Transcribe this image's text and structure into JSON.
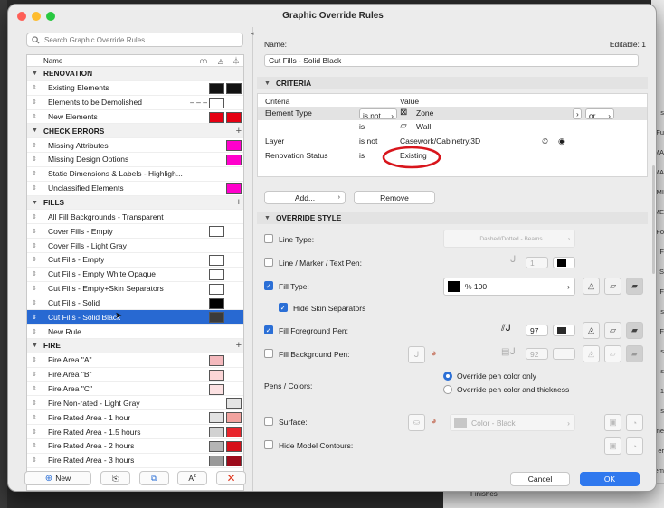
{
  "window": {
    "title": "Graphic Override Rules",
    "colors": {
      "close": "#fe5f57",
      "minimize": "#febc2e",
      "maximize": "#28c840"
    }
  },
  "left_panel": {
    "search_placeholder": "Search Graphic Override Rules",
    "column_name": "Name",
    "groups": [
      {
        "title": "RENOVATION",
        "has_plus": false,
        "items": [
          {
            "label": "Existing Elements",
            "sw1": "#111111",
            "sw2": "#111111"
          },
          {
            "label": "Elements to be Demolished",
            "dashes": "– – –",
            "sw1": "#ffffff",
            "sw2": ""
          },
          {
            "label": "New Elements",
            "sw1": "#e50012",
            "sw2": "#e50012"
          }
        ]
      },
      {
        "title": "CHECK ERRORS",
        "has_plus": true,
        "items": [
          {
            "label": "Missing Attributes",
            "sw1": "",
            "sw2": "#ff00cc"
          },
          {
            "label": "Missing Design Options",
            "sw1": "",
            "sw2": "#ff00cc"
          },
          {
            "label": "Static Dimensions & Labels - Highligh...",
            "sw1": "",
            "sw2": ""
          },
          {
            "label": "Unclassified Elements",
            "sw1": "",
            "sw2": "#ff00cc"
          }
        ]
      },
      {
        "title": "FILLS",
        "has_plus": true,
        "items": [
          {
            "label": "All Fill Backgrounds - Transparent",
            "sw1": "",
            "sw2": ""
          },
          {
            "label": "Cover Fills - Empty",
            "sw1": "#ffffff",
            "sw2": ""
          },
          {
            "label": "Cover Fills - Light Gray",
            "sw1": "",
            "sw2": ""
          },
          {
            "label": "Cut Fills - Empty",
            "sw1": "#ffffff",
            "sw2": ""
          },
          {
            "label": "Cut Fills - Empty White Opaque",
            "sw1": "#ffffff",
            "sw2": ""
          },
          {
            "label": "Cut Fills - Empty+Skin Separators",
            "sw1": "#ffffff",
            "sw2": ""
          },
          {
            "label": "Cut Fills - Solid",
            "sw1": "#000000",
            "sw2": ""
          },
          {
            "label": "Cut Fills - Solid Black",
            "sw1": "#3b3b3b",
            "sw2": "",
            "selected": true
          },
          {
            "label": "New Rule",
            "sw1": "",
            "sw2": ""
          }
        ]
      },
      {
        "title": "FIRE",
        "has_plus": true,
        "items": [
          {
            "label": "Fire Area \"A\"",
            "sw1": "#f4b9bd",
            "sw2": ""
          },
          {
            "label": "Fire Area \"B\"",
            "sw1": "#fbd5d6",
            "sw2": ""
          },
          {
            "label": "Fire Area \"C\"",
            "sw1": "#fce1e2",
            "sw2": ""
          },
          {
            "label": "Fire Non-rated - Light Gray",
            "sw1": "",
            "sw2": "#e4e4e4"
          },
          {
            "label": "Fire Rated Area - 1 hour",
            "sw1": "#e2e2e2",
            "sw2": "#f2a39f"
          },
          {
            "label": "Fire Rated Area - 1.5 hours",
            "sw1": "#d2d2d2",
            "sw2": "#e8252c"
          },
          {
            "label": "Fire Rated Area - 2 hours",
            "sw1": "#b4b4b4",
            "sw2": "#d6101a"
          },
          {
            "label": "Fire Rated Area - 3 hours",
            "sw1": "#9a9a9a",
            "sw2": "#9c0b1b"
          }
        ]
      }
    ],
    "buttons": {
      "new": "New"
    }
  },
  "right_panel": {
    "name_label": "Name:",
    "name_value": "Cut Fills - Solid Black",
    "editable": "Editable: 1",
    "criteria_title": "CRITERIA",
    "criteria_col1": "Criteria",
    "criteria_col2": "Value",
    "criteria_rows": [
      {
        "criterion": "Element Type",
        "op": "is not",
        "value": "Zone",
        "logic": "or",
        "highlight": true
      },
      {
        "criterion": "",
        "op": "is",
        "value": "Wall",
        "logic": "",
        "highlight": false
      },
      {
        "criterion": "Layer",
        "op": "is not",
        "value": "Casework/Cabinetry.3D",
        "logic": "",
        "highlight": false
      },
      {
        "criterion": "Renovation Status",
        "op": "is",
        "value": "Existing",
        "logic": "",
        "highlight": false
      }
    ],
    "add_button": "Add...",
    "remove_button": "Remove",
    "override_title": "OVERRIDE STYLE",
    "line_type_label": "Line Type:",
    "line_type_value": "Dashed/Dotted - Beams",
    "line_marker_label": "Line / Marker / Text Pen:",
    "line_marker_pen": "1",
    "fill_type_label": "Fill Type:",
    "fill_type_value": "% 100",
    "hide_skin_label": "Hide Skin Separators",
    "fill_fg_label": "Fill Foreground Pen:",
    "fill_fg_pen": "97",
    "fill_bg_label": "Fill Background Pen:",
    "fill_bg_pen": "92",
    "pens_colors_label": "Pens / Colors:",
    "radio1": "Override pen color only",
    "radio2": "Override pen color and thickness",
    "surface_label": "Surface:",
    "surface_value": "Color - Black",
    "hide_contours_label": "Hide Model Contours:",
    "cancel": "Cancel",
    "ok": "OK"
  },
  "background": {
    "right_strip": [
      "s",
      "Fu",
      "MA",
      "MA",
      "IMI",
      "ME",
      "Fo",
      "F",
      "S",
      "F",
      "s",
      "F",
      "s",
      "s",
      "1",
      "s",
      "me",
      "er",
      "Elem"
    ],
    "bottom_item": "Finishes"
  }
}
